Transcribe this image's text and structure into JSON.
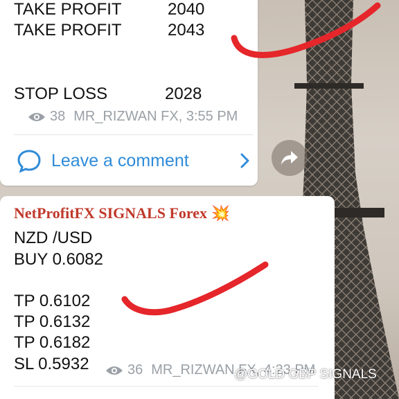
{
  "colors": {
    "channel_red": "#c0392b",
    "link_blue": "#2f8bd8",
    "meta_gray": "#9aa0a6",
    "marker_red": "#e5262b"
  },
  "post1": {
    "take_profit_1_label": "TAKE PROFIT",
    "take_profit_1_value": "2040",
    "take_profit_2_label": "TAKE PROFIT",
    "take_profit_2_value": "2043",
    "stop_loss_label": "STOP LOSS",
    "stop_loss_value": "2028",
    "views": "38",
    "author_time": "MR_RIZWAN FX, 3:55 PM",
    "comment_label": "Leave a comment",
    "icons": [
      "eye-icon",
      "comment-bubble-icon",
      "chevron-right-icon",
      "share-icon"
    ]
  },
  "post2": {
    "channel_name": "NetProfitFX SIGNALS Forex",
    "channel_emoji": "💥",
    "pair": "NZD /USD",
    "buy": "BUY 0.6082",
    "tp1": "TP 0.6102",
    "tp2": "TP 0.6132",
    "tp3": "TP 0.6182",
    "sl": "SL 0.5932",
    "views": "36",
    "author_time": "MR_RIZWAN FX, 4:23 PM"
  },
  "watermark": "@GOLD GBP SIGNALS"
}
